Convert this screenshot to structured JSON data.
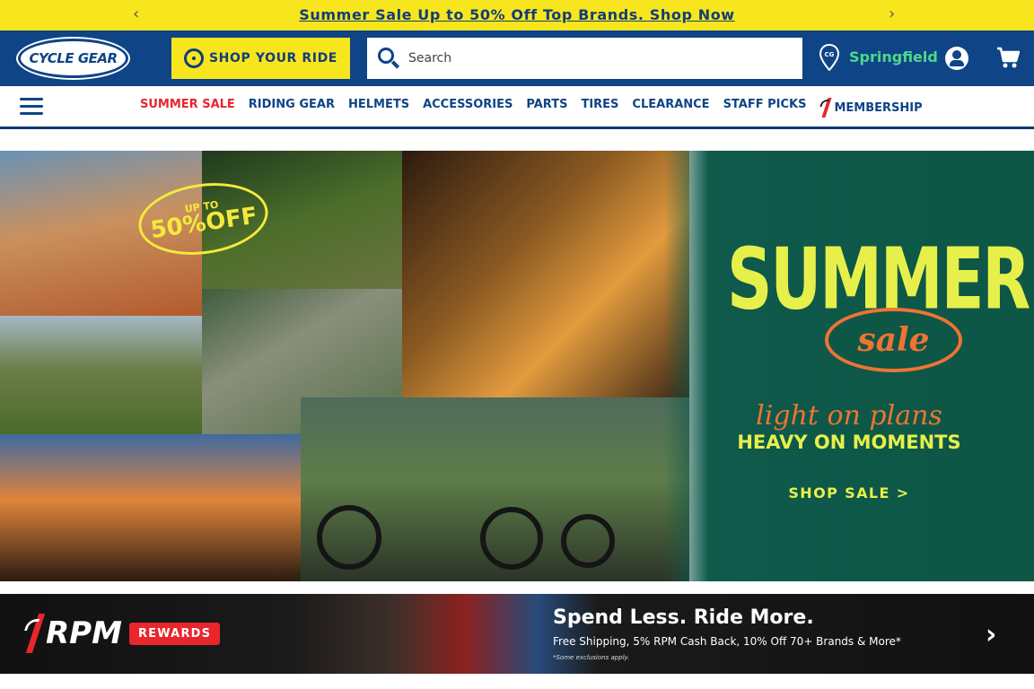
{
  "promo": {
    "prev_arrow": "‹",
    "next_arrow": "›",
    "text": "Summer Sale Up to 50% Off Top Brands. Shop Now"
  },
  "header": {
    "logo_text": "CYCLE GEAR",
    "shop_ride_label": "SHOP YOUR RIDE",
    "search_placeholder": "Search",
    "store_location": "Springfield"
  },
  "nav": {
    "items": [
      {
        "label": "SUMMER SALE"
      },
      {
        "label": "RIDING GEAR"
      },
      {
        "label": "HELMETS"
      },
      {
        "label": "ACCESSORIES"
      },
      {
        "label": "PARTS"
      },
      {
        "label": "TIRES"
      },
      {
        "label": "CLEARANCE"
      },
      {
        "label": "STAFF PICKS"
      },
      {
        "label": "MEMBERSHIP"
      }
    ]
  },
  "hero": {
    "badge_top": "UP TO",
    "badge_pct": "50%OFF",
    "headline": "SUMMER",
    "headline_script": "sale",
    "tagline_script": "light on plans",
    "tagline": "HEAVY ON MOMENTS",
    "cta": "SHOP SALE >"
  },
  "rewards": {
    "logo_word": "RPM",
    "logo_tag": "REWARDS",
    "headline": "Spend Less. Ride More.",
    "subline": "Free Shipping, 5% RPM Cash Back, 10% Off 70+ Brands & More*",
    "disclaimer": "*Some exclusions apply.",
    "next_arrow": "›"
  },
  "colors": {
    "promo_bg": "#f7e61e",
    "brand_blue": "#0f4487",
    "location_green": "#4cd98a",
    "sale_red": "#e8262c",
    "hero_green": "#0e5646",
    "hero_yellow": "#e7f04a",
    "hero_orange": "#ee7433"
  }
}
